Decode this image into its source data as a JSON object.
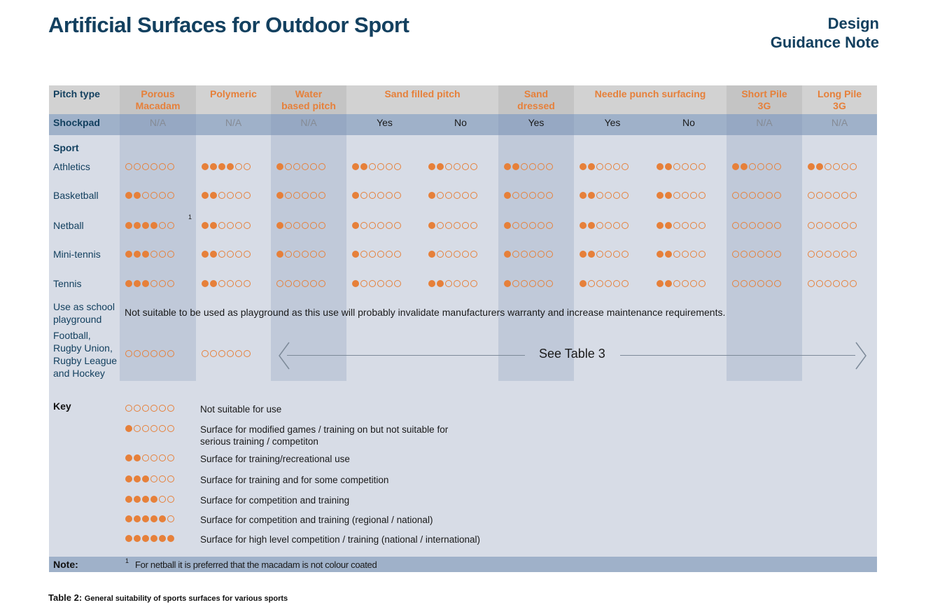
{
  "header": {
    "title": "Artificial Surfaces for Outdoor Sport",
    "brand_line1": "Design",
    "brand_line2": "Guidance Note"
  },
  "colors": {
    "accent": "#e6803a",
    "navy": "#13405f"
  },
  "table": {
    "pitch_type_label": "Pitch type",
    "shockpad_label": "Shockpad",
    "sport_label": "Sport",
    "surfaces": [
      "Porous Macadam",
      "Polymeric",
      "Water based pitch",
      "Sand filled pitch",
      "Sand dressed",
      "Needle punch surfacing",
      "Short Pile 3G",
      "Long Pile 3G"
    ],
    "shockpad_values": [
      "N/A",
      "N/A",
      "N/A",
      "Yes",
      "No",
      "Yes",
      "Yes",
      "No",
      "N/A",
      "N/A"
    ],
    "sports": [
      {
        "name": "Athletics",
        "ratings": [
          0,
          4,
          1,
          2,
          2,
          2,
          2,
          2,
          2,
          2
        ]
      },
      {
        "name": "Basketball",
        "ratings": [
          2,
          2,
          1,
          1,
          1,
          1,
          2,
          2,
          0,
          0
        ]
      },
      {
        "name": "Netball",
        "ratings": [
          4,
          2,
          1,
          1,
          1,
          1,
          2,
          2,
          0,
          0
        ],
        "footnote": "1"
      },
      {
        "name": "Mini-tennis",
        "ratings": [
          3,
          2,
          1,
          1,
          1,
          1,
          2,
          2,
          0,
          0
        ]
      },
      {
        "name": "Tennis",
        "ratings": [
          3,
          2,
          0,
          1,
          2,
          1,
          1,
          2,
          0,
          0
        ]
      }
    ],
    "playground_label": "Use as school playground",
    "playground_text": "Not suitable to be used as playground as this use will probably invalidate manufacturers warranty and increase maintenance requirements.",
    "football_label": "Football, Rugby Union, Rugby League and Hockey",
    "football_ratings": [
      0,
      0
    ],
    "see_table": "See Table 3"
  },
  "key": {
    "label": "Key",
    "items": [
      {
        "level": 0,
        "text": "Not suitable for use"
      },
      {
        "level": 1,
        "text": "Surface for modified games / training on but not suitable for serious training / competiton"
      },
      {
        "level": 2,
        "text": "Surface for training/recreational use"
      },
      {
        "level": 3,
        "text": "Surface for training and for some competition"
      },
      {
        "level": 4,
        "text": "Surface for competition and training"
      },
      {
        "level": 5,
        "text": "Surface for competition and training (regional / national)"
      },
      {
        "level": 6,
        "text": "Surface for high level competition / training (national / international)"
      }
    ]
  },
  "note": {
    "label": "Note:",
    "number": "1",
    "text": "For netball it is preferred that the macadam is not colour coated"
  },
  "caption": {
    "prefix": "Table 2:",
    "text": "General suitability of sports surfaces for various sports"
  }
}
